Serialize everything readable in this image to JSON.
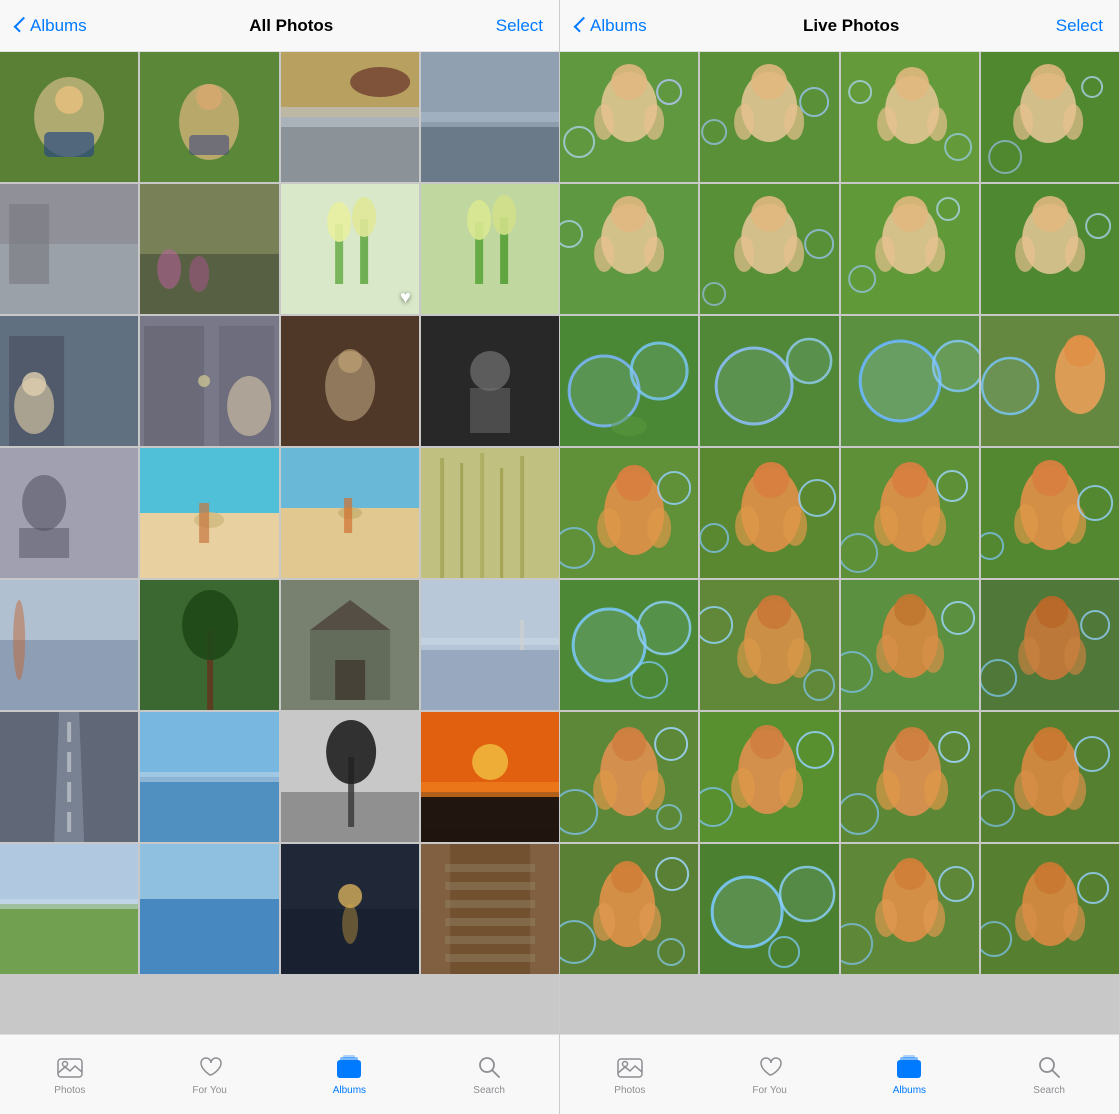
{
  "panels": [
    {
      "id": "all-photos",
      "header": {
        "back_label": "Albums",
        "title": "All Photos",
        "action_label": "Select"
      },
      "photos": [
        {
          "id": "p1",
          "color": "c-green-child"
        },
        {
          "id": "p2",
          "color": "c-child-grass"
        },
        {
          "id": "p3",
          "color": "c-ocean-sunset"
        },
        {
          "id": "p4",
          "color": "c-ocean-grey"
        },
        {
          "id": "p5",
          "color": "c-grey-wall"
        },
        {
          "id": "p6",
          "color": "c-field-flowers"
        },
        {
          "id": "p7",
          "color": "c-tulips-w",
          "heart": true
        },
        {
          "id": "p8",
          "color": "c-tulips-g"
        },
        {
          "id": "p9",
          "color": "c-door-dog"
        },
        {
          "id": "p10",
          "color": "c-door-grey"
        },
        {
          "id": "p11",
          "color": "c-child-bw"
        },
        {
          "id": "p12",
          "color": "c-child-bw2"
        },
        {
          "id": "p13",
          "color": "c-jump-bw"
        },
        {
          "id": "p14",
          "color": "c-beach-teal"
        },
        {
          "id": "p15",
          "color": "c-beach-surf"
        },
        {
          "id": "p16",
          "color": "c-reeds"
        },
        {
          "id": "p17",
          "color": "c-misty-water"
        },
        {
          "id": "p18",
          "color": "c-lone-tree"
        },
        {
          "id": "p19",
          "color": "c-cottage"
        },
        {
          "id": "p20",
          "color": "c-misty-sea"
        },
        {
          "id": "p21",
          "color": "c-road-bw"
        },
        {
          "id": "p22",
          "color": "c-sea-blue"
        },
        {
          "id": "p23",
          "color": "c-tree-bw"
        },
        {
          "id": "p24",
          "color": "c-sunset-orange"
        },
        {
          "id": "p25",
          "color": "c-field-green"
        },
        {
          "id": "p26",
          "color": "c-sea-blue"
        },
        {
          "id": "p27",
          "color": "c-lake-dark"
        },
        {
          "id": "p28",
          "color": "c-stairs"
        }
      ],
      "tabs": [
        {
          "id": "photos",
          "label": "Photos",
          "icon": "photos",
          "active": false
        },
        {
          "id": "for-you",
          "label": "For You",
          "icon": "heart",
          "active": false
        },
        {
          "id": "albums",
          "label": "Albums",
          "icon": "albums",
          "active": true
        },
        {
          "id": "search",
          "label": "Search",
          "icon": "search",
          "active": false
        }
      ]
    },
    {
      "id": "live-photos",
      "header": {
        "back_label": "Albums",
        "title": "Live Photos",
        "action_label": "Select"
      },
      "photos": [
        {
          "id": "l1",
          "color": "c-grass-baby"
        },
        {
          "id": "l2",
          "color": "c-grass-baby2"
        },
        {
          "id": "l3",
          "color": "c-grass-baby3"
        },
        {
          "id": "l4",
          "color": "c-grass-baby4"
        },
        {
          "id": "l5",
          "color": "c-grass-baby"
        },
        {
          "id": "l6",
          "color": "c-grass-baby2"
        },
        {
          "id": "l7",
          "color": "c-grass-baby3"
        },
        {
          "id": "l8",
          "color": "c-grass-baby4"
        },
        {
          "id": "l9",
          "color": "c-grass-baby"
        },
        {
          "id": "l10",
          "color": "c-grass-bubble"
        },
        {
          "id": "l11",
          "color": "c-grass-bubble"
        },
        {
          "id": "l12",
          "color": "c-grass-baby2"
        },
        {
          "id": "l13",
          "color": "c-grass-bubble"
        },
        {
          "id": "l14",
          "color": "c-grass-bubble"
        },
        {
          "id": "l15",
          "color": "c-grass-bubble"
        },
        {
          "id": "l16",
          "color": "c-grass-orange"
        },
        {
          "id": "l17",
          "color": "c-grass-orange"
        },
        {
          "id": "l18",
          "color": "c-grass-bubble"
        },
        {
          "id": "l19",
          "color": "c-grass-bubble"
        },
        {
          "id": "l20",
          "color": "c-grass-orange"
        },
        {
          "id": "l21",
          "color": "c-grass-orange"
        },
        {
          "id": "l22",
          "color": "c-grass-bubble"
        },
        {
          "id": "l23",
          "color": "c-grass-bubble"
        },
        {
          "id": "l24",
          "color": "c-grass-orange"
        },
        {
          "id": "l25",
          "color": "c-grass-orange"
        },
        {
          "id": "l26",
          "color": "c-grass-orange"
        },
        {
          "id": "l27",
          "color": "c-grass-bubble"
        },
        {
          "id": "l28",
          "color": "c-grass-orange"
        }
      ],
      "tabs": [
        {
          "id": "photos",
          "label": "Photos",
          "icon": "photos",
          "active": false
        },
        {
          "id": "for-you",
          "label": "For You",
          "icon": "heart",
          "active": false
        },
        {
          "id": "albums",
          "label": "Albums",
          "icon": "albums",
          "active": true
        },
        {
          "id": "search",
          "label": "Search",
          "icon": "search",
          "active": false
        }
      ]
    }
  ],
  "colors": {
    "blue": "#007AFF",
    "tab_active": "#007AFF",
    "tab_inactive": "#8e8e93"
  }
}
